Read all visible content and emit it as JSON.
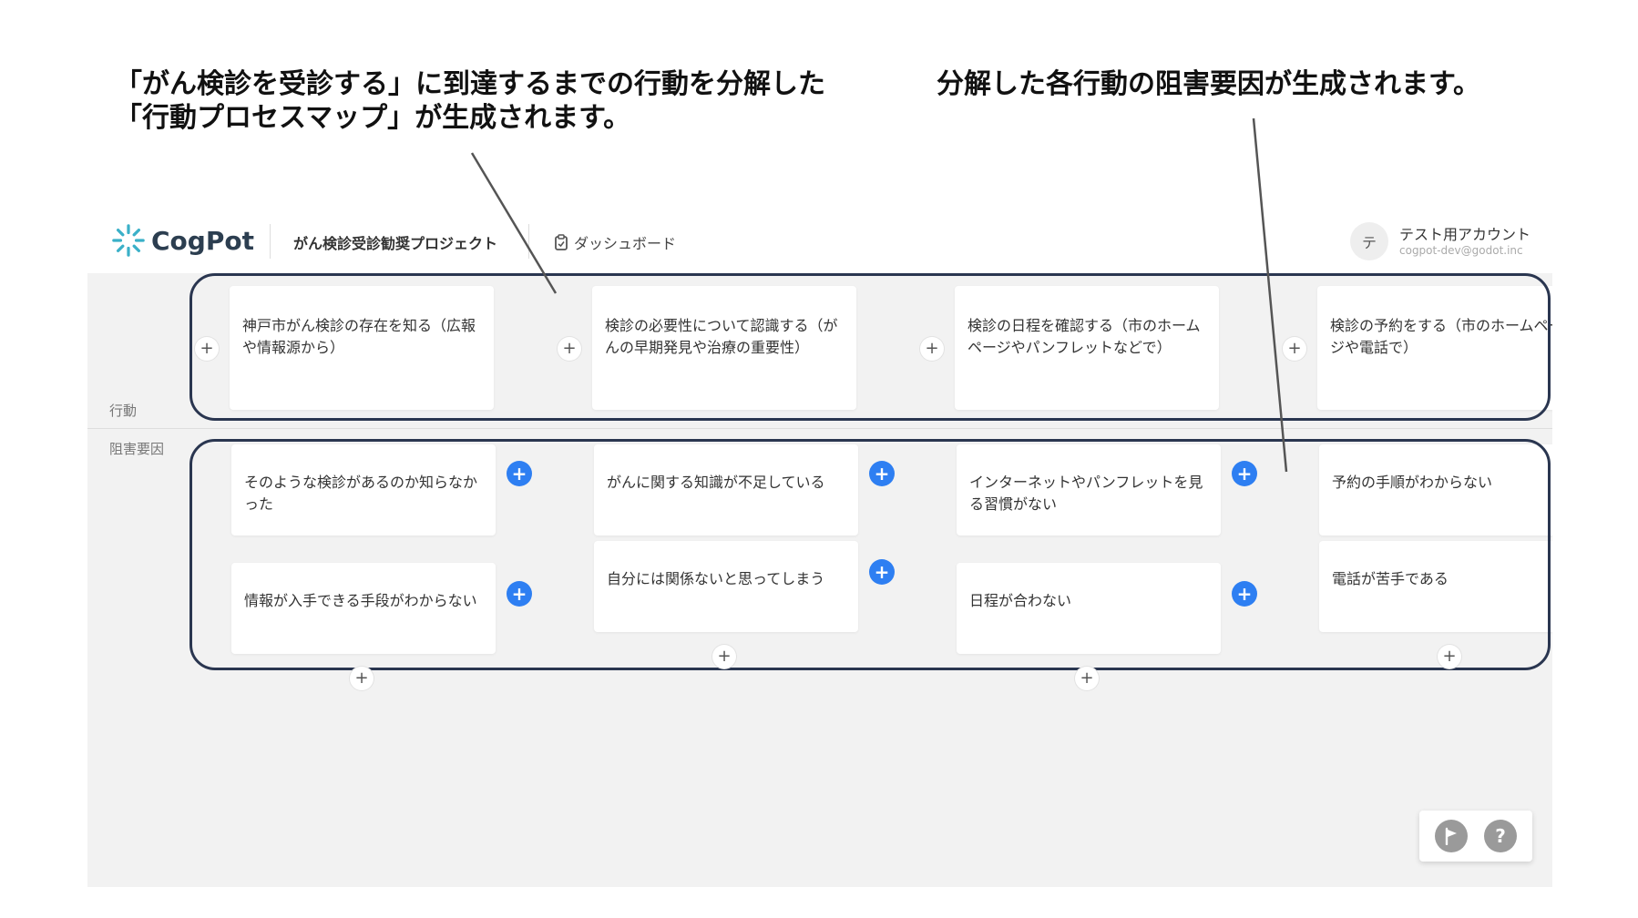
{
  "captions": {
    "left_line1": "「がん検診を受診する」に到達するまでの行動を分解した",
    "left_line2": "「行動プロセスマップ」が生成されます。",
    "right": "分解した各行動の阻害要因が生成されます。"
  },
  "header": {
    "logo_text": "CogPot",
    "project_name": "がん検診受診勧奨プロジェクト",
    "dashboard_label": "ダッシュボード",
    "avatar_initial": "テ",
    "account_name": "テスト用アカウント",
    "account_email": "cogpot-dev@godot.inc"
  },
  "rows": {
    "action_label": "行動",
    "barrier_label": "阻害要因"
  },
  "actions": [
    {
      "text": "神戸市がん検診の存在を知る（広報や情報源から）"
    },
    {
      "text": "検診の必要性について認識する（がんの早期発見や治療の重要性）"
    },
    {
      "text": "検診の日程を確認する（市のホームページやパンフレットなどで）"
    },
    {
      "text": "検診の予約をする（市のホームページや電話で）"
    }
  ],
  "barriers": [
    [
      "そのような検診があるのか知らなかった",
      "情報が入手できる手段がわからない"
    ],
    [
      "がんに関する知識が不足している",
      "自分には関係ないと思ってしまう"
    ],
    [
      "インターネットやパンフレットを見る習慣がない",
      "日程が合わない"
    ],
    [
      "予約の手順がわからない",
      "電話が苦手である"
    ]
  ],
  "icons": {
    "plus": "+",
    "help": "?",
    "add_icon": "plus-icon",
    "flag_icon": "flag-icon",
    "help_icon": "question-icon",
    "dashboard_icon": "clipboard-icon"
  },
  "colors": {
    "accent_blue": "#2e7ff2",
    "outline": "#2a3650",
    "logo_teal": "#3ab0c8"
  }
}
